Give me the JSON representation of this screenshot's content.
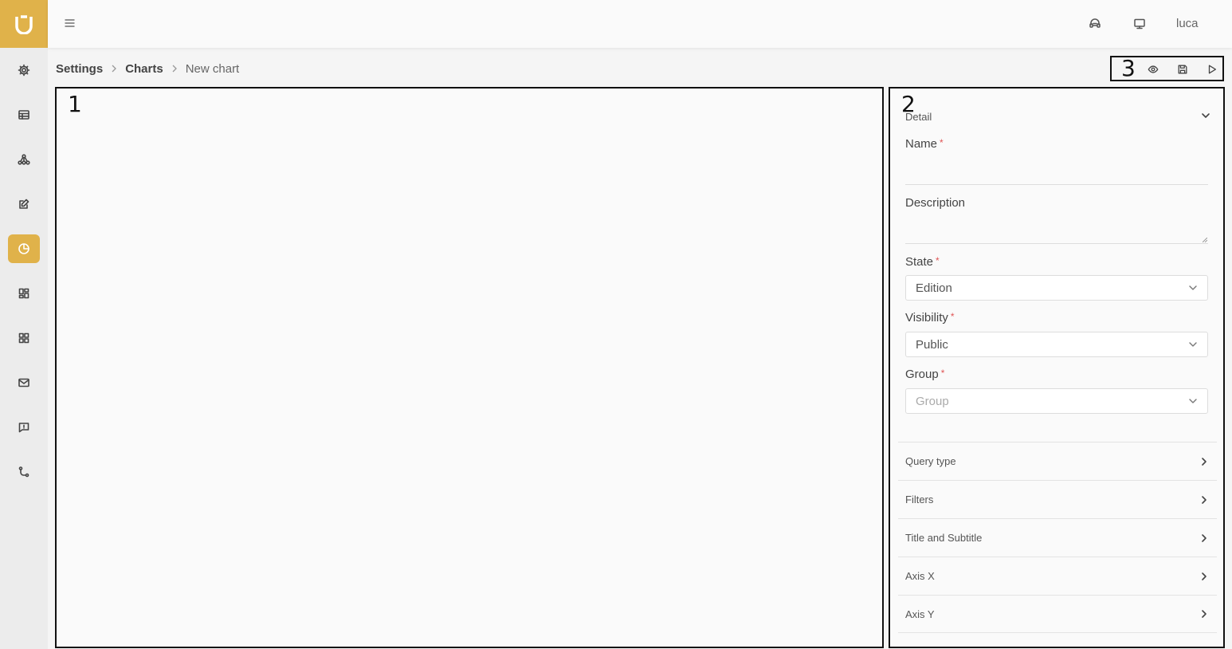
{
  "user": {
    "name": "luca"
  },
  "breadcrumb": {
    "settings": "Settings",
    "charts": "Charts",
    "current": "New chart"
  },
  "boxes": {
    "canvas": "1",
    "panel": "2",
    "toolbar": "3"
  },
  "panel": {
    "detail_title": "Detail",
    "name_label": "Name",
    "description_label": "Description",
    "state_label": "State",
    "state_value": "Edition",
    "visibility_label": "Visibility",
    "visibility_value": "Public",
    "group_label": "Group",
    "group_placeholder": "Group",
    "required_mark": "*",
    "sections": [
      "Query type",
      "Filters",
      "Title and Subtitle",
      "Axis X",
      "Axis Y"
    ]
  },
  "colors": {
    "accent": "#e0b24a",
    "required": "#e05555"
  },
  "icons": {
    "sidebar": [
      "settings-icon",
      "table-icon",
      "hierarchy-icon",
      "edit-icon",
      "pie-chart-icon",
      "dashboard-icon",
      "grid-icon",
      "mail-icon",
      "chat-icon",
      "flow-icon"
    ],
    "topbar": [
      "menu-icon",
      "support-icon",
      "monitor-icon"
    ],
    "toolbar": [
      "eye-icon",
      "save-icon",
      "play-icon"
    ]
  }
}
